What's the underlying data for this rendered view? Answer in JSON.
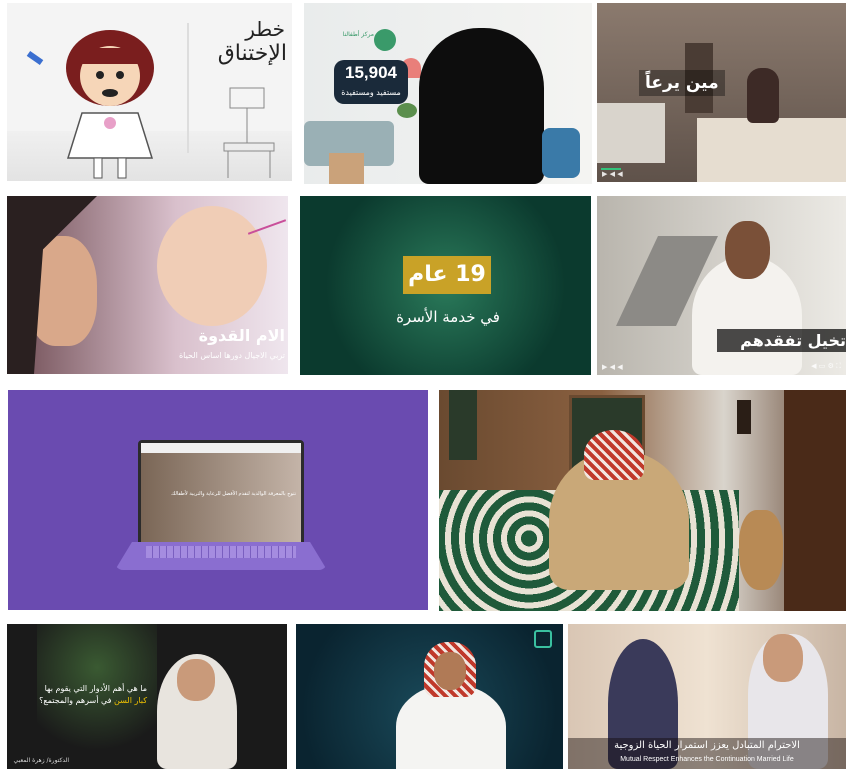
{
  "gallery": {
    "v1": {
      "title_line1": "خطر",
      "title_line2": "الإختناق"
    },
    "v2": {
      "org_name": "مركز أطفالنا",
      "count": "15,904",
      "count_caption": "مستفيد ومستفيدة"
    },
    "v3": {
      "caption": "مين يرعاً"
    },
    "v4": {
      "title": "الام القدوة",
      "subtitle": "تربي الاجيال دورها اساس الحياة"
    },
    "v5": {
      "number_text": "19 عام",
      "subtitle": "في خدمة الأسرة"
    },
    "v6": {
      "caption": "تخيل تفقدهم"
    },
    "v7": {
      "screen_headline": "نتوج بالمعرفة الوالدية لتقدم الأفضل للرعاية والتربية لأطفالك"
    },
    "v8": {},
    "v9": {
      "question_line1": "ما هي أهم الأدوار التي يقوم بها",
      "question_highlight": "كبار السن",
      "question_line2": "في أسرهم والمجتمع؟",
      "speaker_name": "الدكتورة/ زهرة المعبي"
    },
    "v10": {},
    "v11": {
      "caption_ar": "الاحترام المتبادل يعزز استمرار الحياة الزوجية",
      "caption_en": "Mutual Respect Enhances the Continuation Married Life"
    }
  },
  "colors": {
    "accent_green": "#1f8a5a",
    "gold": "#c9a227",
    "purple": "#6a4bb0",
    "yellow": "#f2c200"
  }
}
